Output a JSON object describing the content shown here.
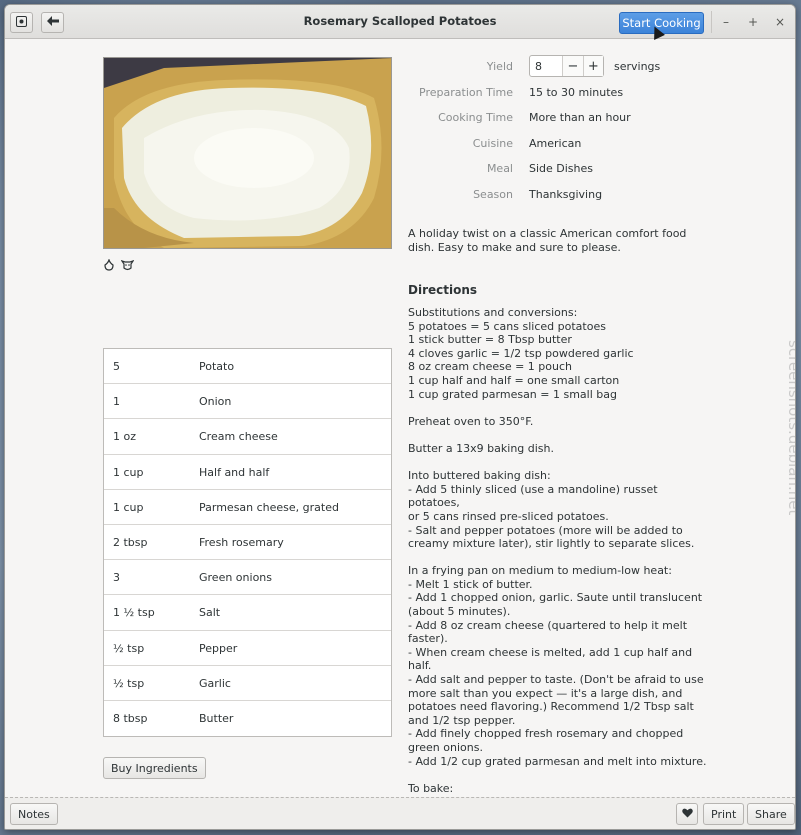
{
  "window": {
    "title": "Rosemary Scalloped Potatoes",
    "start_cooking_label": "Start Cooking"
  },
  "details": {
    "yield_label": "Yield",
    "yield_value": "8",
    "yield_unit": "servings",
    "rows": [
      {
        "label": "Preparation Time",
        "value": "15 to 30 minutes"
      },
      {
        "label": "Cooking Time",
        "value": "More than an hour"
      },
      {
        "label": "Cuisine",
        "value": "American"
      },
      {
        "label": "Meal",
        "value": "Side Dishes"
      },
      {
        "label": "Season",
        "value": "Thanksgiving"
      }
    ]
  },
  "description": "A holiday twist on a classic American comfort food dish. Easy to make and sure to please.",
  "directions_heading": "Directions",
  "directions_text": "Substitutions and conversions:\n5 potatoes = 5 cans sliced potatoes\n1 stick butter = 8 Tbsp butter\n4 cloves garlic = 1/2 tsp powdered garlic\n8 oz cream cheese = 1 pouch\n1 cup half and half = one small carton\n1 cup grated parmesan = 1 small bag\n\nPreheat oven to 350°F.\n\nButter a 13x9 baking dish.\n\nInto buttered baking dish:\n- Add 5 thinly sliced (use a mandoline) russet potatoes,\nor 5 cans rinsed pre-sliced potatoes.\n- Salt and pepper potatoes (more will be added to\ncreamy mixture later), stir lightly to separate slices.\n\nIn a frying pan on medium to medium-low heat:\n- Melt 1 stick of butter.\n- Add 1 chopped onion, garlic. Saute until translucent\n(about 5 minutes).\n- Add 8 oz cream cheese (quartered to help it melt\nfaster).\n- When cream cheese is melted, add 1 cup half and\nhalf.\n- Add salt and pepper to taste. (Don't be afraid to use\nmore salt than you expect — it's a large dish, and\npotatoes need flavoring.) Recommend 1/2 Tbsp salt\nand 1/2 tsp pepper.\n- Add finely chopped fresh rosemary and chopped\ngreen onions.\n- Add 1/2 cup grated parmesan and melt into mixture.\n\nTo bake:\n- Pour mixture over potatoes, stirring a bit to help the\nsauce cover everywhere. If using canned potatoes, be",
  "ingredients": [
    {
      "amount": "5",
      "name": "Potato"
    },
    {
      "amount": "1",
      "name": "Onion"
    },
    {
      "amount": "1 oz",
      "name": "Cream cheese"
    },
    {
      "amount": "1 cup",
      "name": "Half and half"
    },
    {
      "amount": "1 cup",
      "name": "Parmesan cheese, grated"
    },
    {
      "amount": "2 tbsp",
      "name": "Fresh rosemary"
    },
    {
      "amount": "3",
      "name": "Green onions"
    },
    {
      "amount": "1 ½ tsp",
      "name": "Salt"
    },
    {
      "amount": "½ tsp",
      "name": "Pepper"
    },
    {
      "amount": "½ tsp",
      "name": "Garlic"
    },
    {
      "amount": "8 tbsp",
      "name": "Butter"
    }
  ],
  "buy_ingredients_label": "Buy Ingredients",
  "bottombar": {
    "notes_label": "Notes",
    "print_label": "Print",
    "share_label": "Share"
  },
  "watermark": "screenshots.debian.net",
  "icons": {
    "menu": "app-menu-icon",
    "back": "back-arrow-icon",
    "minimize": "minimize-icon",
    "maximize": "maximize-icon",
    "close": "close-icon",
    "favorite": "heart-icon"
  },
  "colors": {
    "accent": "#3c83d9",
    "window_bg": "#f6f5f4"
  }
}
